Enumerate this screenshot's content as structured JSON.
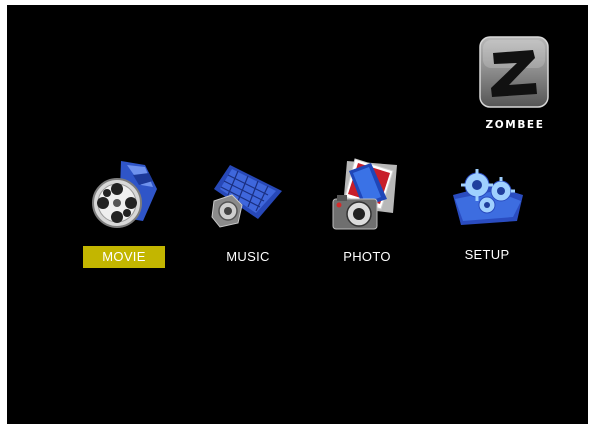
{
  "brand": {
    "logo_letter": "Z",
    "name": "ZOMBEE"
  },
  "menu": {
    "selected_index": 0,
    "items": [
      {
        "label": "MOVIE",
        "icon": "film-reel-icon"
      },
      {
        "label": "MUSIC",
        "icon": "keyboard-speaker-icon"
      },
      {
        "label": "PHOTO",
        "icon": "camera-photos-icon"
      },
      {
        "label": "SETUP",
        "icon": "gears-folder-icon"
      }
    ]
  },
  "colors": {
    "background": "#000000",
    "selection": "#c3b600",
    "label": "#ffffff"
  }
}
